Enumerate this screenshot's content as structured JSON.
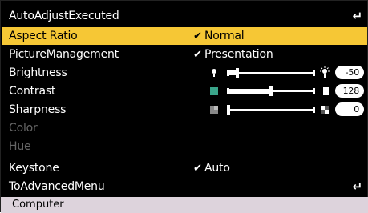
{
  "menu": {
    "items": [
      {
        "label": "AutoAdjustExecuted",
        "enter": "↵"
      },
      {
        "label": "Aspect Ratio",
        "value": "Normal",
        "check": "✔"
      },
      {
        "label": "PictureManagement",
        "value": "Presentation",
        "check": "✔"
      },
      {
        "label": "Brightness",
        "number": "-50"
      },
      {
        "label": "Contrast",
        "number": "128"
      },
      {
        "label": "Sharpness",
        "number": "0"
      },
      {
        "label": "Color"
      },
      {
        "label": "Hue"
      },
      {
        "label": "Keystone",
        "value": "Auto",
        "check": "✔"
      },
      {
        "label": "ToAdvancedMenu",
        "enter": "↵"
      }
    ]
  },
  "sliders": {
    "brightness": {
      "level": 0.1
    },
    "contrast": {
      "level": 0.5
    },
    "sharpness": {
      "level": 0.0
    }
  },
  "status": {
    "source": "Computer"
  },
  "colors": {
    "background": "#000000",
    "selected": "#f6c735",
    "disabled": "#666666",
    "statusbar": "#ddd3dc"
  }
}
